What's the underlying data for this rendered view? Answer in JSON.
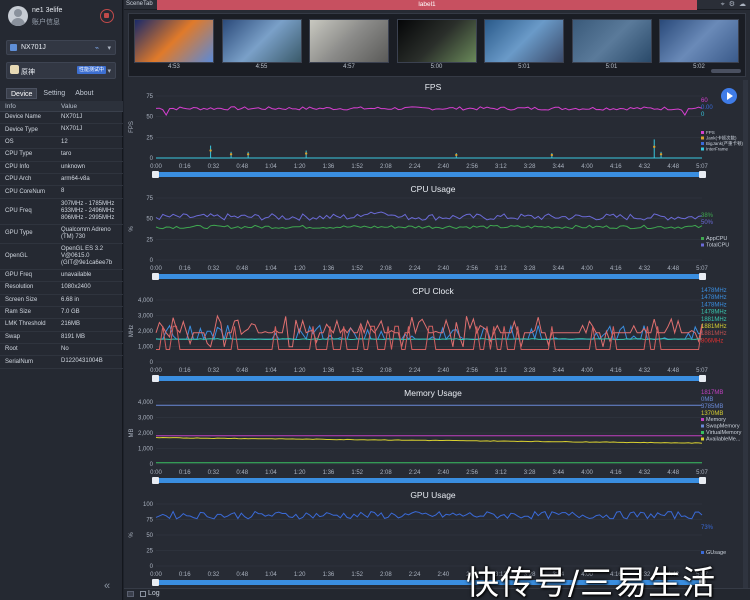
{
  "user": {
    "name": "ne1 3elife",
    "info": "账户信息"
  },
  "device_selector": {
    "label": "NX701J"
  },
  "app_selector": {
    "label": "原神",
    "badge": "性能测试中"
  },
  "tabs": [
    {
      "label": "Device"
    },
    {
      "label": "Setting"
    },
    {
      "label": "About"
    }
  ],
  "info_header": {
    "key": "Info",
    "value": "Value"
  },
  "info_rows": [
    {
      "k": "Device Name",
      "v": "NX701J"
    },
    {
      "k": "Device Type",
      "v": "NX701J"
    },
    {
      "k": "OS",
      "v": "12"
    },
    {
      "k": "CPU Type",
      "v": "taro"
    },
    {
      "k": "CPU Info",
      "v": "unknown"
    },
    {
      "k": "CPU Arch",
      "v": "arm64-v8a"
    },
    {
      "k": "CPU CoreNum",
      "v": "8"
    },
    {
      "k": "CPU Freq",
      "v": "307MHz - 1785MHz\n633MHz - 2496MHz\n806MHz - 2995MHz"
    },
    {
      "k": "GPU Type",
      "v": "Qualcomm Adreno (TM) 730"
    },
    {
      "k": "OpenGL",
      "v": "OpenGL ES 3.2 V@0615.0 (GIT@9e1ca6ee7b"
    },
    {
      "k": "GPU Freq",
      "v": "unavailable"
    },
    {
      "k": "Resolution",
      "v": "1080x2400"
    },
    {
      "k": "Screen Size",
      "v": "6.68 in"
    },
    {
      "k": "Ram Size",
      "v": "7.0 GB"
    },
    {
      "k": "LMK Threshold",
      "v": "216MB"
    },
    {
      "k": "Swap",
      "v": "8191 MB"
    },
    {
      "k": "Root",
      "v": "No"
    },
    {
      "k": "SerialNum",
      "v": "D1220431004B"
    }
  ],
  "topbar": {
    "scene_tab": "SceneTab",
    "label": "label1"
  },
  "thumbnails": [
    {
      "time": "4:53",
      "colors": [
        "#1a2a6a",
        "#e07a2a",
        "#5a8ad8"
      ]
    },
    {
      "time": "4:55",
      "colors": [
        "#2b4a7a",
        "#7aa0c8",
        "#3a5a6a"
      ]
    },
    {
      "time": "4:57",
      "colors": [
        "#c8c8c0",
        "#8a8a88",
        "#5a5a58"
      ]
    },
    {
      "time": "5:00",
      "colors": [
        "#050608",
        "#2a2e2a",
        "#6a8a5a"
      ]
    },
    {
      "time": "5:01",
      "colors": [
        "#2a5a8a",
        "#6a9ac8",
        "#3a4a6a"
      ]
    },
    {
      "time": "5:01",
      "colors": [
        "#3a5a7a",
        "#5a7a9a",
        "#2a4a6a"
      ]
    },
    {
      "time": "5:02",
      "colors": [
        "#2a4a7a",
        "#6a8ab8",
        "#3a5a8a"
      ]
    }
  ],
  "x_ticks": [
    "0:00",
    "0:16",
    "0:32",
    "0:48",
    "1:04",
    "1:20",
    "1:36",
    "1:52",
    "2:08",
    "2:24",
    "2:40",
    "2:56",
    "3:12",
    "3:28",
    "3:44",
    "4:00",
    "4:16",
    "4:32",
    "4:48",
    "5:07"
  ],
  "colors": {
    "fps": "#d63fd0",
    "jank": "#d8a030",
    "bigjank": "#3a6ad8",
    "interframe": "#38c8e0",
    "app_cpu": "#3fa850",
    "total_cpu": "#6b6bd8",
    "memory": "#c040c0",
    "swap": "#6a8ad8",
    "virtual": "#38c060",
    "available": "#d8d030",
    "gusage": "#3a6ad8",
    "accent": "#3f7ce8",
    "brand_bar": "#c75060"
  },
  "charts": {
    "fps": {
      "title": "FPS",
      "y_axis": "FPS",
      "yticks": [
        "75",
        "50",
        "25",
        "0"
      ],
      "values": [
        "60",
        "0.00",
        "0"
      ],
      "legend": [
        "FPS",
        "Jank(卡顿次数)",
        "BigJank(严重卡顿)",
        "InterFrame"
      ]
    },
    "cpu": {
      "title": "CPU Usage",
      "y_axis": "%",
      "yticks": [
        "75",
        "50",
        "25",
        "0"
      ],
      "values": [
        "38%",
        "50%"
      ],
      "legend": [
        "AppCPU",
        "TotalCPU"
      ]
    },
    "clock": {
      "title": "CPU Clock",
      "y_axis": "MHz",
      "yticks": [
        "4,000",
        "3,000",
        "2,000",
        "1,000",
        "0"
      ],
      "values": [
        "1478MHz",
        "1478MHz",
        "1478MHz",
        "1478MHz",
        "1881MHz",
        "1881MHz",
        "1881MHz",
        "806MHz"
      ]
    },
    "memory": {
      "title": "Memory Usage",
      "y_axis": "MB",
      "yticks": [
        "4,000",
        "3,000",
        "2,000",
        "1,000",
        "0"
      ],
      "values": [
        "1817MB",
        "0MB",
        "3785MB",
        "1370MB"
      ],
      "legend": [
        "Memory",
        "SwapMemory",
        "VirtualMemory",
        "AvailableMe..."
      ]
    },
    "gpu": {
      "title": "GPU Usage",
      "y_axis": "%",
      "yticks": [
        "100",
        "75",
        "50",
        "25",
        "0"
      ],
      "values": [
        "73%"
      ],
      "legend": [
        "GUsage"
      ]
    }
  },
  "bottom": {
    "log": "Log"
  },
  "watermark": "快传号/三易生活"
}
